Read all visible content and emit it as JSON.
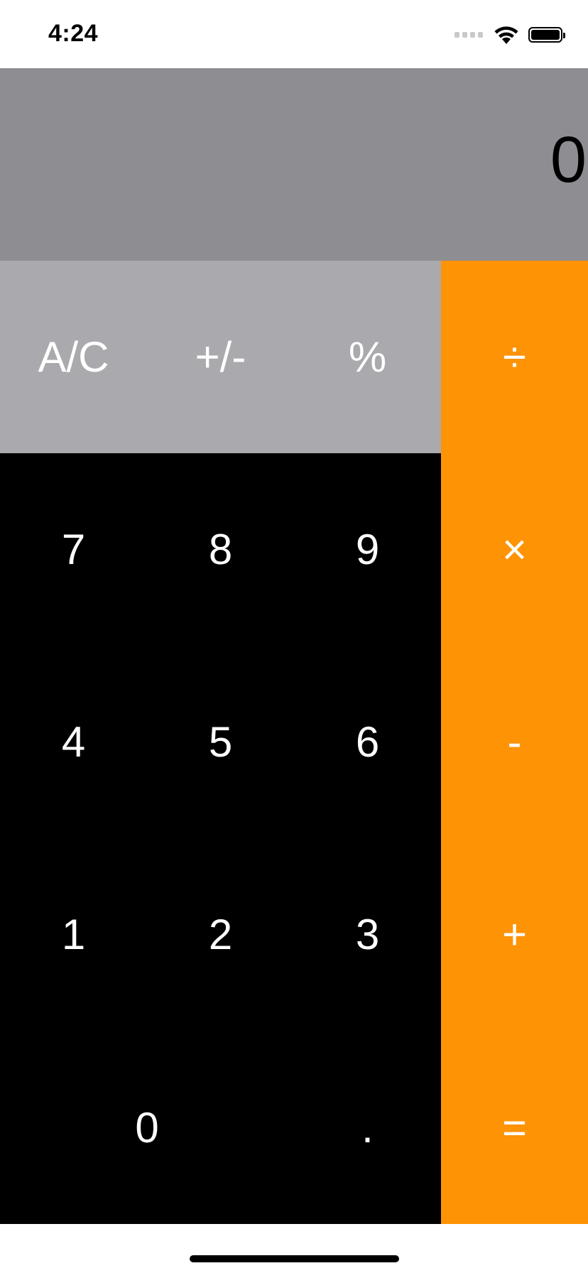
{
  "status_bar": {
    "time": "4:24",
    "icons": [
      "cellular-signal-icon",
      "wifi-icon",
      "battery-icon"
    ]
  },
  "display": {
    "value": "0"
  },
  "keys": {
    "clear": "A/C",
    "sign": "+/-",
    "percent": "%",
    "divide": "÷",
    "seven": "7",
    "eight": "8",
    "nine": "9",
    "multiply": "×",
    "four": "4",
    "five": "5",
    "six": "6",
    "subtract": "-",
    "one": "1",
    "two": "2",
    "three": "3",
    "add": "+",
    "zero": "0",
    "decimal": ".",
    "equals": "="
  },
  "colors": {
    "display_bg": "#8e8d91",
    "function_key_bg": "#aaa9ad",
    "number_key_bg": "#000000",
    "operator_key_bg": "#fe9305",
    "key_text": "#ffffff"
  }
}
